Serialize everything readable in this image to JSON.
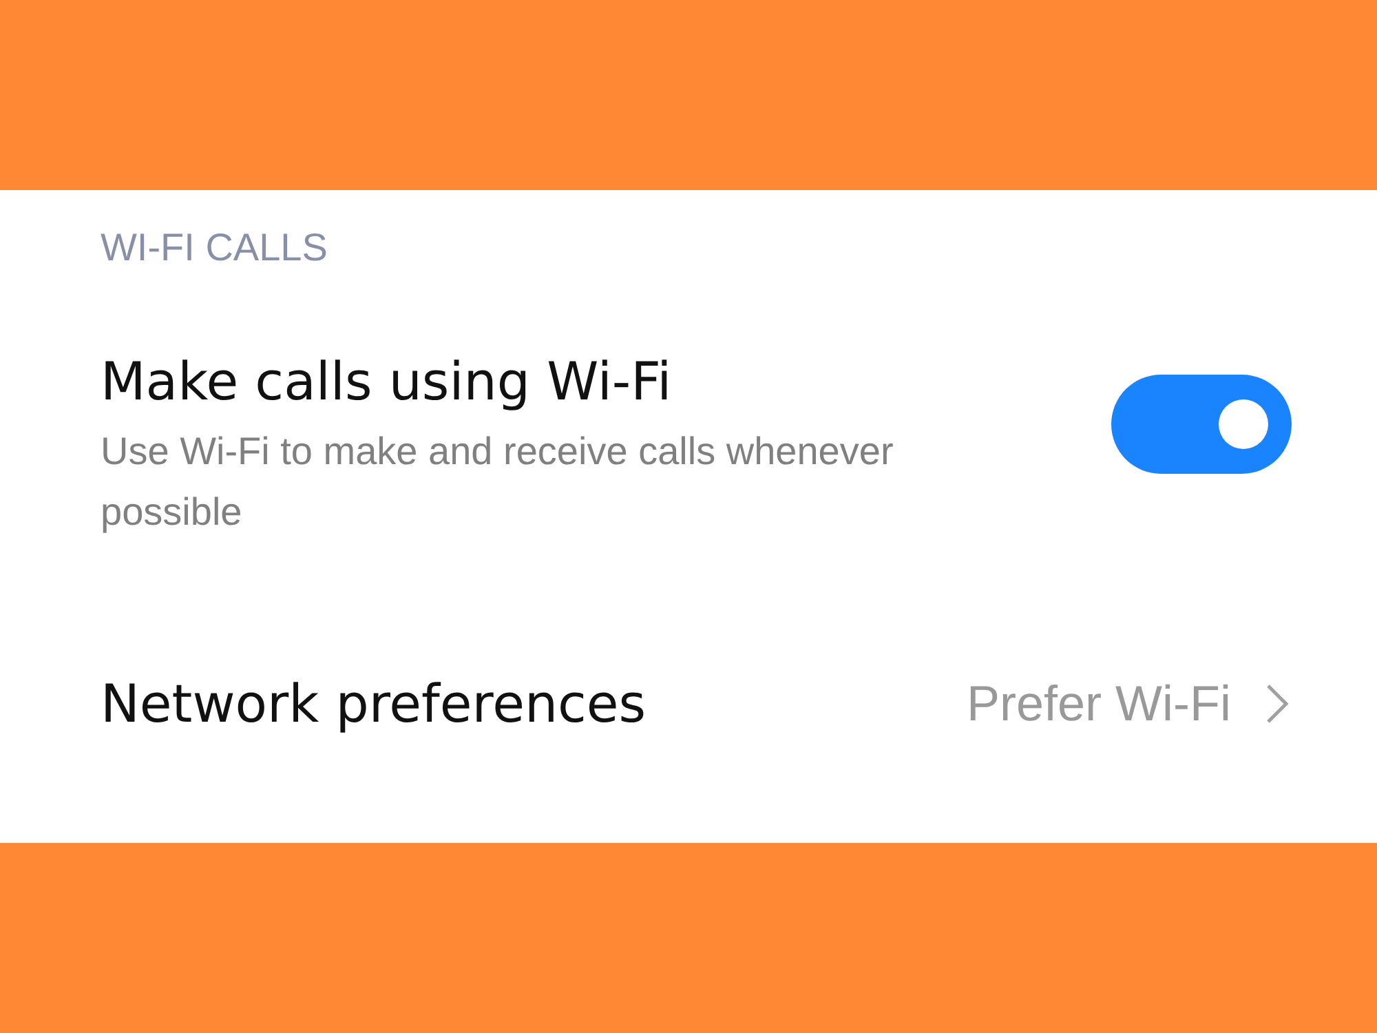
{
  "section": {
    "header": "WI-FI CALLS",
    "items": [
      {
        "kind": "toggle",
        "title": "Make calls using Wi-Fi",
        "subtitle": "Use Wi-Fi to make and receive calls whenever possible",
        "on": true
      },
      {
        "kind": "link",
        "title": "Network preferences",
        "value": "Prefer Wi-Fi"
      }
    ]
  }
}
